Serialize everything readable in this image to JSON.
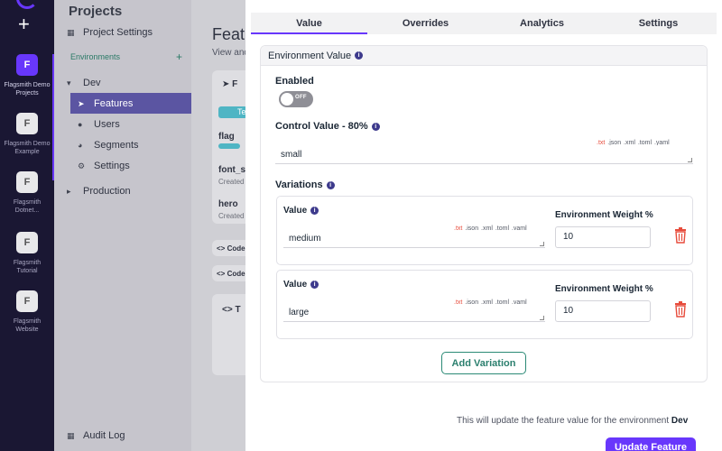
{
  "rail": {
    "orgs": [
      {
        "letter": "F",
        "name": "Flagsmith Demo Projects",
        "active": true
      },
      {
        "letter": "F",
        "name": "Flagsmith Demo Example",
        "active": false
      },
      {
        "letter": "F",
        "name": "Flagsmith Dotnet...",
        "active": false
      },
      {
        "letter": "F",
        "name": "Flagsmith Tutorial",
        "active": false
      },
      {
        "letter": "F",
        "name": "Flagsmith Website",
        "active": false
      }
    ],
    "add_label": "+"
  },
  "sidebar": {
    "title": "Projects",
    "project_settings": "Project Settings",
    "environments_label": "Environments",
    "env_add": "+",
    "dev": "Dev",
    "items": [
      "Features",
      "Users",
      "Segments",
      "Settings"
    ],
    "production": "Production",
    "audit_log": "Audit Log"
  },
  "main": {
    "title": "Featu",
    "subtitle": "View and",
    "tag": "Te",
    "rows": [
      {
        "name": "flag",
        "meta": ""
      },
      {
        "name": "font_s",
        "meta": "Created"
      },
      {
        "name": "hero",
        "meta": "Created"
      }
    ],
    "code_labels": [
      "Code",
      "Code"
    ],
    "bottom_label": "T"
  },
  "modal": {
    "tabs": [
      "Value",
      "Overrides",
      "Analytics",
      "Settings"
    ],
    "active_tab": 0,
    "section_title": "Environment Value",
    "enabled_label": "Enabled",
    "toggle_text": "OFF",
    "control_label": "Control Value - 80%",
    "control_value": "small",
    "langs": [
      ".txt",
      ".json",
      ".xml",
      ".toml",
      ".yaml"
    ],
    "variations_label": "Variations",
    "variations": [
      {
        "value_label": "Value",
        "value": "medium",
        "weight_label": "Environment Weight %",
        "weight": "10"
      },
      {
        "value_label": "Value",
        "value": "large",
        "weight_label": "Environment Weight %",
        "weight": "10"
      }
    ],
    "add_variation": "Add Variation",
    "footer_note": "This will update the feature value for the environment",
    "footer_env": "Dev",
    "update_button": "Update Feature"
  },
  "colors": {
    "accent": "#6837fc",
    "rail": "#1a1733",
    "secondary": "#2b8a76",
    "danger": "#e74c3c"
  }
}
